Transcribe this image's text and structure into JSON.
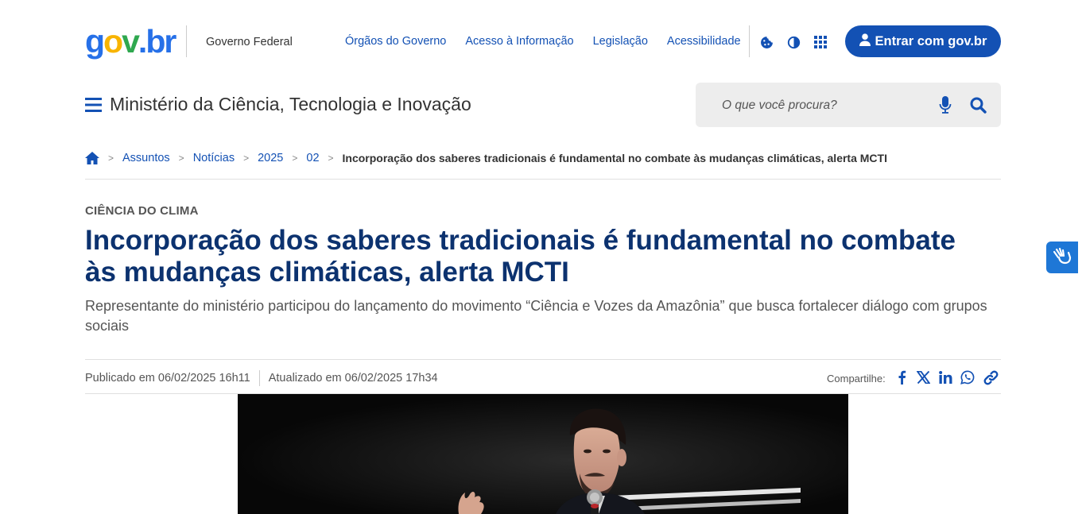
{
  "header": {
    "logo_text": "gov.br",
    "logo_parts": [
      "g",
      "o",
      "v",
      ".",
      "b",
      "r"
    ],
    "org_name": "Governo Federal",
    "links": [
      "Órgãos do Governo",
      "Acesso à Informação",
      "Legislação",
      "Acessibilidade"
    ],
    "tool_icons": [
      "cookie-icon",
      "contrast-icon",
      "apps-grid-icon"
    ],
    "login_label": "Entrar com gov.br",
    "site_title": "Ministério da Ciência, Tecnologia e Inovação",
    "search": {
      "placeholder": "O que você procura?"
    }
  },
  "breadcrumb": {
    "items": [
      "Assuntos",
      "Notícias",
      "2025",
      "02"
    ],
    "current": "Incorporação dos saberes tradicionais é fundamental no combate às mudanças climáticas, alerta MCTI"
  },
  "article": {
    "kicker": "CIÊNCIA DO CLIMA",
    "title": "Incorporação dos saberes tradicionais é fundamental no combate às mudanças climáticas, alerta MCTI",
    "subtitle": "Representante do ministério participou do lançamento do movimento “Ciência e Vozes da Amazônia” que busca fortalecer diálogo com grupos sociais",
    "published": "Publicado em 06/02/2025 16h11",
    "updated": "Atualizado em 06/02/2025 17h34",
    "share_label": "Compartilhe:",
    "share_icons": [
      "facebook-icon",
      "x-icon",
      "linkedin-icon",
      "whatsapp-icon",
      "link-icon"
    ]
  },
  "colors": {
    "primary": "#1351b4",
    "title": "#0c326f",
    "logo_blue": "#2670e8",
    "logo_yellow": "#f8b400",
    "logo_green": "#2fa84f",
    "vlibras": "#1e77d6"
  }
}
